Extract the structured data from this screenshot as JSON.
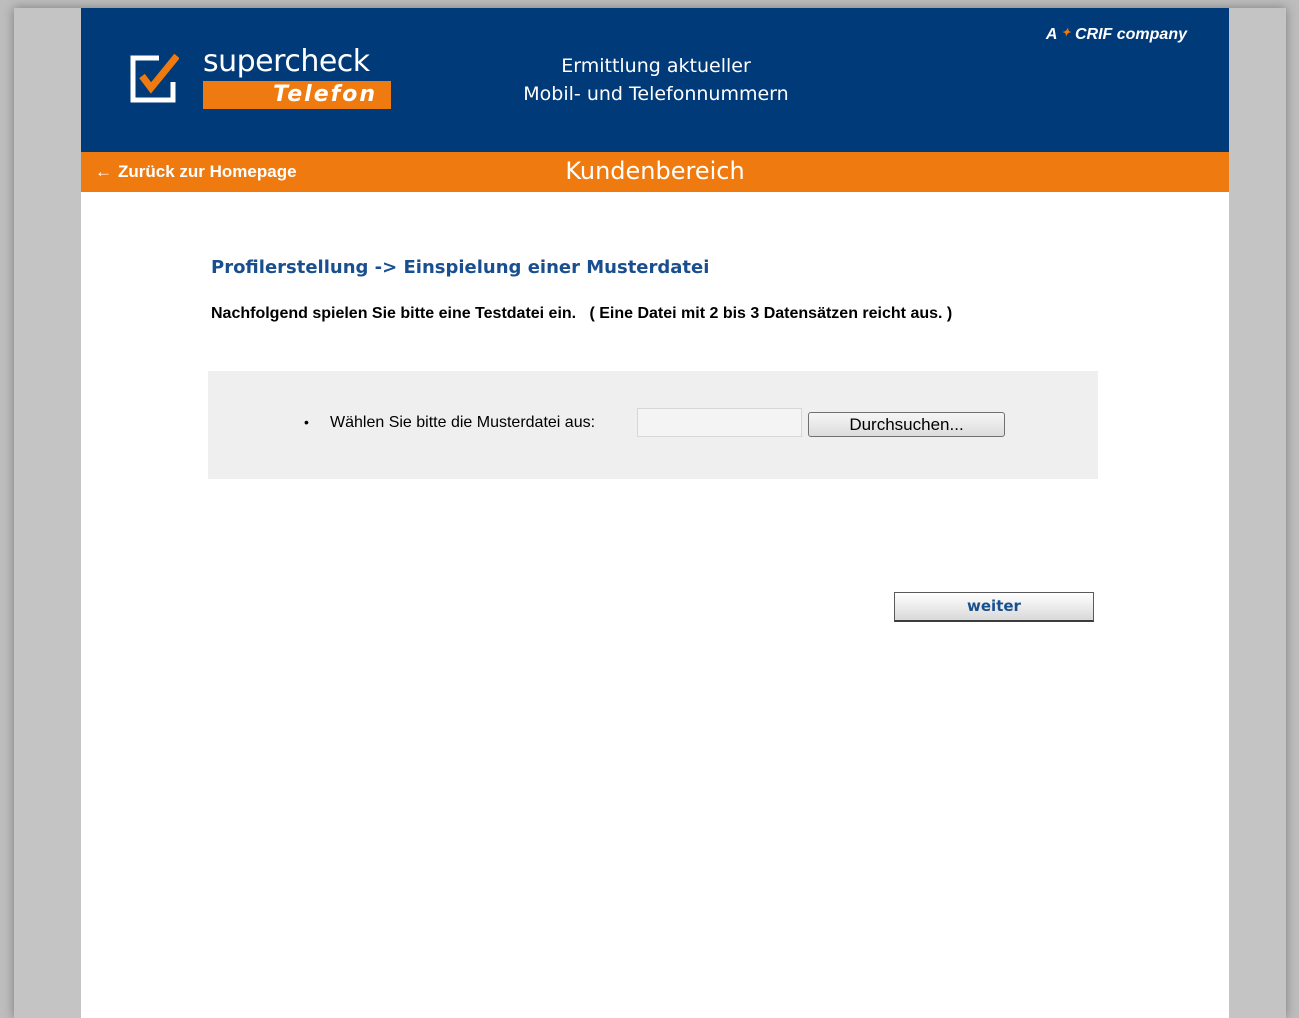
{
  "header": {
    "logo_word": "supercheck",
    "logo_sub": "Telefon",
    "tagline_line1": "Ermittlung aktueller",
    "tagline_line2": "Mobil- und Telefonnummern",
    "crif_prefix": "A",
    "crif_name": "CRIF company"
  },
  "nav": {
    "back_label": "Zurück zur Homepage",
    "section_title": "Kundenbereich"
  },
  "main": {
    "heading": "Profilerstellung -> Einspielung einer Musterdatei",
    "instruction": "Nachfolgend spielen Sie bitte eine Testdatei ein.   ( Eine Datei mit 2 bis 3 Datensätzen reicht aus. )",
    "upload": {
      "bullet": "•",
      "label": "Wählen Sie bitte die Musterdatei aus:",
      "file_value": "",
      "browse_label": "Durchsuchen..."
    },
    "next_label": "weiter"
  },
  "colors": {
    "brand_blue": "#003a78",
    "brand_orange": "#ef7b10",
    "heading_blue": "#1a4f8f"
  },
  "icons": {
    "back": "left-arrow-icon",
    "logo_mark": "checkmark-box-icon"
  }
}
